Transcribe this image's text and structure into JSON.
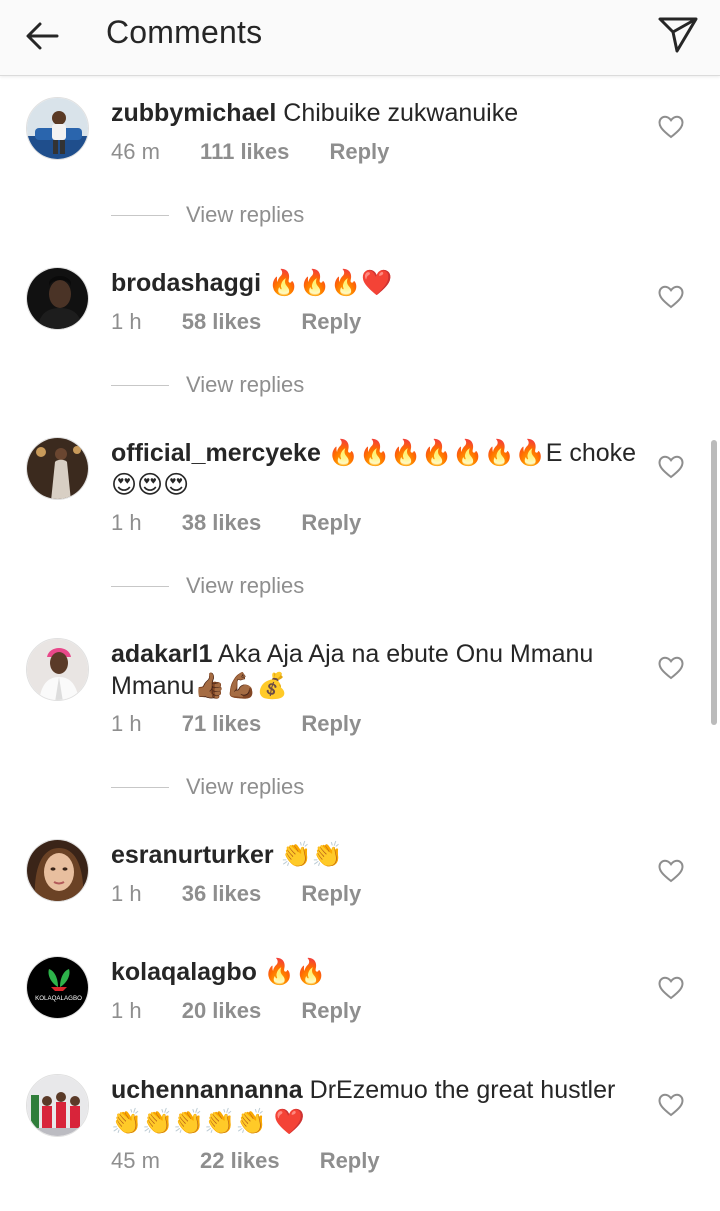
{
  "header": {
    "title": "Comments"
  },
  "comments": [
    {
      "username": "zubbymichael",
      "text": "Chibuike zukwanuike",
      "time": "46 m",
      "likes": "111 likes",
      "reply": "Reply",
      "view_replies": "View replies",
      "avatar": "avatar-blue-room"
    },
    {
      "username": "brodashaggi",
      "text": "🔥🔥🔥❤️",
      "time": "1 h",
      "likes": "58 likes",
      "reply": "Reply",
      "view_replies": "View replies",
      "avatar": "avatar-dark-portrait"
    },
    {
      "username": "official_mercyeke",
      "text": "🔥🔥🔥🔥🔥🔥🔥E choke 😍😍😍",
      "time": "1 h",
      "likes": "38 likes",
      "reply": "Reply",
      "view_replies": "View replies",
      "avatar": "avatar-gown"
    },
    {
      "username": "adakarl1",
      "text": "Aka Aja Aja na ebute Onu Mmanu Mmanu👍🏾💪🏾💰",
      "time": "1 h",
      "likes": "71 likes",
      "reply": "Reply",
      "view_replies": "View replies",
      "avatar": "avatar-pink-hair"
    },
    {
      "username": "esranurturker",
      "text": "👏👏",
      "time": "1 h",
      "likes": "36 likes",
      "reply": "Reply",
      "avatar": "avatar-face"
    },
    {
      "username": "kolaqalagbo",
      "text": "🔥🔥",
      "time": "1 h",
      "likes": "20 likes",
      "reply": "Reply",
      "avatar": "avatar-logo",
      "avatar_text": "KOLAQALAGBO"
    },
    {
      "username": "uchennannanna",
      "text": "DrEzemuo the great hustler 👏👏👏👏👏 ❤️",
      "time": "45 m",
      "likes": "22 likes",
      "reply": "Reply",
      "avatar": "avatar-family"
    }
  ],
  "icons": {
    "back": "back-arrow-icon",
    "share": "send-icon",
    "like": "heart-outline-icon"
  },
  "colors": {
    "text": "#262626",
    "secondary": "#8e8e8e",
    "divider": "#dbdbdb",
    "header_bg": "#fafafa"
  }
}
